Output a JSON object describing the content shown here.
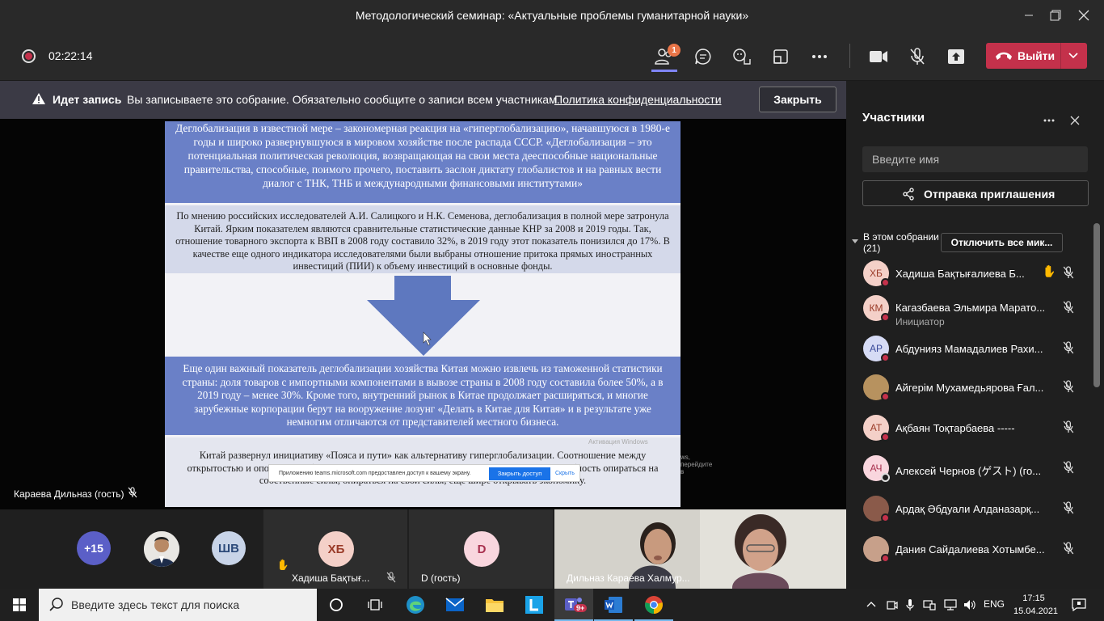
{
  "window": {
    "title": "Методологический семинар: «Актуальные проблемы гуманитарной науки»"
  },
  "toolbar": {
    "timer": "02:22:14",
    "participants_badge": "1",
    "leave_label": "Выйти"
  },
  "banner": {
    "title": "Идет запись",
    "message": "Вы записываете это собрание. Обязательно сообщите о записи всем участникам.",
    "link": "Политика конфиденциальности",
    "close_label": "Закрыть"
  },
  "slide": {
    "block1": "Деглобализация в известной мере – закономерная реакция на «гиперглобализацию», начавшуюся в 1980-е годы и широко развернувшуюся в мировом хозяйстве после распада СССР. «Деглобализация – это потенциальная политическая революция, возвращающая на свои места дееспособные национальные правительства, способные, поимого прочего, поставить заслон диктату глобалистов и на равных вести диалог с ТНК, ТНБ и международными финансовыми институтами»",
    "block2": "По мнению российских исследователей А.И. Салицкого и Н.К. Семенова, деглобализация в полной мере затронула Китай. Ярким показателем являются сравнительные статистические данные КНР за 2008 и 2019 годы. Так, отношение товарного экспорта к ВВП в 2008 году составило 32%, в 2019 году этот показатель понизился до 17%. В качестве еще одного индикатора исследователями были выбраны отношение притока прямых иностранных инвестиций (ПИИ) к объему инвестиций в основные фонды.",
    "block3": "Еще один важный показатель деглобализации хозяйства Китая можно извлечь из таможенной статистики страны: доля товаров с импортными компонентами в вывозе страны в 2008 году составила более 50%, а в 2019 году – менее 30%. Кроме того, внутренний рынок в Китае продолжает расширяться, и многие зарубежные корпорации берут на вооружение лозунг «Делать в Китае для Китая» и в результате уже немногим отличаются от представителей местного бизнеса.",
    "block4": "Китай развернул инициативу «Пояса и пути» как альтернативу гиперглобализации. Соотношение между открытостью и опорой на собственные силы, в которой Китай стремится укреплять способность опираться на собственные силы, опираться на свои силы, еще шире открывать экономику.",
    "ghost_text_1": "Активация Windows",
    "ghost_text_2": "ws, перейдите в",
    "share_bar": {
      "text": "Приложению teams.microsoft.com предоставлен доступ к вашему экрану.",
      "grant": "Закрыть доступ",
      "hide": "Скрыть"
    }
  },
  "presenter": {
    "name": "Караева Дильназ (гость)"
  },
  "tiles": {
    "more_count": "+15",
    "shv_initials": "ШВ",
    "hb_initials": "ХБ",
    "hb_name": "Хадиша Бақтығ...",
    "d_initials": "D",
    "d_name": "D (гость)",
    "video_name": "Дильназ Караева Халмур..."
  },
  "panel": {
    "title": "Участники",
    "search_placeholder": "Введите имя",
    "invite_label": "Отправка приглашения",
    "section_label": "В этом собрании",
    "section_count": "(21)",
    "mute_all_label": "Отключить все мик...",
    "participants": [
      {
        "initials": "ХБ",
        "name": "Хадиша Бақтығалиева Б...",
        "sub": "",
        "color": "#f4d0c8",
        "text_color": "#9a3b28",
        "hand": true
      },
      {
        "initials": "КМ",
        "name": "Кагазбаева Эльмира Марато...",
        "sub": "Инициатор",
        "color": "#f4d0c8",
        "text_color": "#9a3b28",
        "hand": false
      },
      {
        "initials": "АР",
        "name": "Абдунияз Мамадалиев Рахи...",
        "sub": "",
        "color": "#d6dbf5",
        "text_color": "#3a4a9a",
        "hand": false
      },
      {
        "initials": "",
        "name": "Айгерім Мухамедьярова Ғал...",
        "sub": "",
        "color": "#b7925f",
        "text_color": "#fff",
        "hand": false
      },
      {
        "initials": "АТ",
        "name": "Ақбаян Тоқтарбаева -----",
        "sub": "",
        "color": "#f4d0c8",
        "text_color": "#9a3b28",
        "hand": false
      },
      {
        "initials": "АЧ",
        "name": "Алексей Чернов (ゲスト) (го...",
        "sub": "",
        "color": "#f9d6de",
        "text_color": "#a8304e",
        "hand": false
      },
      {
        "initials": "",
        "name": "Ардақ Әбдуали Алданазарқ...",
        "sub": "",
        "color": "#8a5a4a",
        "text_color": "#fff",
        "hand": false
      },
      {
        "initials": "",
        "name": "Дания Сайдалиева Хотымбе...",
        "sub": "",
        "color": "#c7a08a",
        "text_color": "#fff",
        "hand": false
      }
    ]
  },
  "taskbar": {
    "search_placeholder": "Введите здесь текст для поиска",
    "teams_badge": "9+",
    "lang": "ENG",
    "time": "17:15",
    "date": "15.04.2021"
  }
}
